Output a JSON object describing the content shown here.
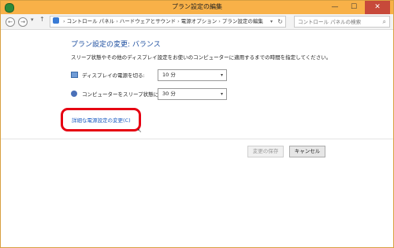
{
  "window": {
    "title": "プラン設定の編集",
    "minimize_glyph": "—",
    "maximize_glyph": "☐",
    "close_glyph": "✕"
  },
  "toolbar": {
    "back_glyph": "←",
    "forward_glyph": "→",
    "up_glyph": "↑",
    "recent_glyph": "▾",
    "breadcrumb": [
      "コントロール パネル",
      "ハードウェアとサウンド",
      "電源オプション",
      "プラン設定の編集"
    ],
    "breadcrumb_sep": "›",
    "dropdown_glyph": "▾",
    "refresh_glyph": "↻",
    "search_placeholder": "コントロール パネルの検索",
    "search_glyph": "⌕"
  },
  "main": {
    "heading": "プラン設定の変更: バランス",
    "description": "スリープ状態やその他のディスプレイ設定をお使いのコンピューターに適用するまでの時間を指定してください。",
    "settings": [
      {
        "label": "ディスプレイの電源を切る:",
        "value": "10 分",
        "icon": "display-icon"
      },
      {
        "label": "コンピューターをスリープ状態にする:",
        "value": "30 分",
        "icon": "sleep-icon"
      }
    ],
    "caret_glyph": "▾",
    "advanced_link": "詳細な電源設定の変更(C)",
    "highlight_color": "#e60012",
    "save_button": "変更の保存",
    "cancel_button": "キャンセル"
  }
}
